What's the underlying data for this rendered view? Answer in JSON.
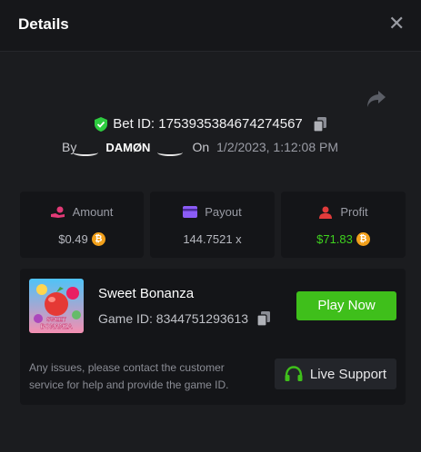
{
  "header": {
    "title": "Details",
    "close_icon": "close-icon"
  },
  "bet": {
    "id_label": "Bet ID: 1753935384674274567",
    "by_label": "By",
    "username": "DAMØN",
    "on_label": "On",
    "date": "1/2/2023, 1:12:08 PM"
  },
  "stats": {
    "amount": {
      "label": "Amount",
      "value": "$0.49",
      "icon": "hand-coin-icon",
      "color": "#e33a77"
    },
    "payout": {
      "label": "Payout",
      "value": "144.7521 x",
      "icon": "card-icon",
      "color": "#8b5cf6"
    },
    "profit": {
      "label": "Profit",
      "value": "$71.83",
      "icon": "profit-user-icon",
      "color": "#e03b3b",
      "value_color": "#3fd21e"
    }
  },
  "game": {
    "name": "Sweet Bonanza",
    "id_label": "Game ID: 8344751293613",
    "thumb_text": "SWEET BONANZA",
    "play_label": "Play Now",
    "notice": "Any issues, please contact the customer service for help and provide the game ID.",
    "support_label": "Live Support"
  },
  "colors": {
    "accent_green": "#3fbf1b",
    "btc_orange": "#f2a01b",
    "shield_green": "#2ecc40"
  }
}
